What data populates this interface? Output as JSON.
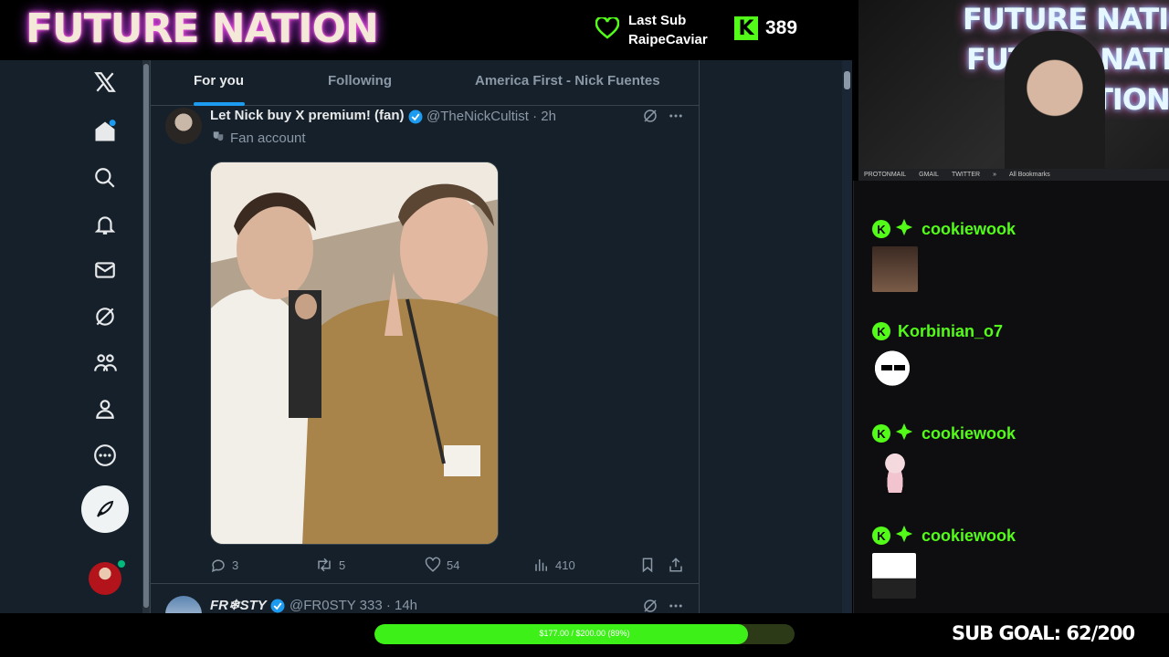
{
  "overlay": {
    "logo_text": "FUTURE NATION",
    "last_sub_label": "Last Sub",
    "last_sub_name": "RaipeCaviar",
    "viewer_count": "389",
    "kick_icon": "K",
    "accent_color": "#53fc18"
  },
  "x": {
    "tabs": [
      {
        "label": "For you",
        "active": true
      },
      {
        "label": "Following",
        "active": false
      },
      {
        "label": "America First - Nick Fuentes",
        "active": false
      }
    ],
    "nav_icons": [
      "x-logo-icon",
      "home-icon",
      "search-icon",
      "notifications-bell-icon",
      "messages-mail-icon",
      "grok-icon",
      "communities-icon",
      "profile-icon",
      "more-icon",
      "post-compose-icon",
      "account-avatar"
    ],
    "post": {
      "display_name": "Let Nick buy X premium! (fan)",
      "handle_time": "@TheNickCultist · 2h",
      "fan_label": "Fan account",
      "replies": "3",
      "reposts": "5",
      "likes": "54",
      "views": "410"
    },
    "post2": {
      "display_name": "FR❄STY",
      "handle_time": "@FR0STY 333 · 14h"
    }
  },
  "webcam": {
    "sign_lines": [
      "FUTURE NATION",
      "FUTURE NATION",
      "NATION"
    ],
    "bookmarks": [
      "PROTONMAIL",
      "GMAIL",
      "TWITTER",
      "»",
      "All Bookmarks"
    ]
  },
  "chat": [
    {
      "username": "cookiewook",
      "has_badge2": true
    },
    {
      "username": "Korbinian_o7",
      "has_badge2": false
    },
    {
      "username": "cookiewook",
      "has_badge2": true
    },
    {
      "username": "cookiewook",
      "has_badge2": true
    }
  ],
  "goal": {
    "progress_text": "$177.00 / $200.00 (89%)",
    "progress_fraction": 0.89,
    "sub_goal_text": "SUB GOAL: 62/200"
  }
}
